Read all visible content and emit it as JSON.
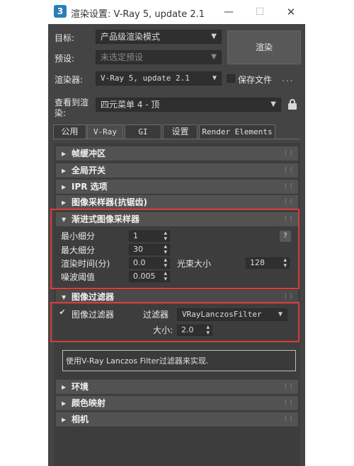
{
  "window": {
    "app_icon": "3",
    "title": "渲染设置: V-Ray 5, update 2.1",
    "minimize_icon": "minimize-icon",
    "maximize_icon": "maximize-icon",
    "close_icon": "close-icon"
  },
  "top": {
    "target_label": "目标:",
    "target_value": "产品级渲染模式",
    "preset_label": "预设:",
    "preset_value": "未选定预设",
    "renderer_label": "渲染器:",
    "renderer_value": "V-Ray 5, update 2.1",
    "save_file_label": "保存文件",
    "more_label": "...",
    "view_label_1": "查看到渲",
    "view_label_2": "染:",
    "view_value": "四元菜单 4 - 顶",
    "render_button": "渲染"
  },
  "tabs": [
    {
      "label": "公用"
    },
    {
      "label": "V-Ray"
    },
    {
      "label": "GI"
    },
    {
      "label": "设置"
    },
    {
      "label": "Render Elements"
    }
  ],
  "active_tab": "V-Ray",
  "rollouts": {
    "frame_buffer": "帧缓冲区",
    "global_switches": "全局开关",
    "ipr_options": "IPR 选项",
    "image_sampler": "图像采样器(抗锯齿)",
    "progressive_sampler": "渐进式图像采样器",
    "image_filter": "图像过滤器",
    "environment": "环境",
    "color_mapping": "颜色映射",
    "camera": "相机"
  },
  "progressive": {
    "min_subdivs_label": "最小细分",
    "min_subdivs_value": "1",
    "max_subdivs_label": "最大细分",
    "max_subdivs_value": "30",
    "render_time_label": "渲染时间(分)",
    "render_time_value": "0.0",
    "bundle_size_label": "光束大小",
    "bundle_size_value": "128",
    "noise_threshold_label": "噪波阈值",
    "noise_threshold_value": "0.005",
    "help_button": "?"
  },
  "filter": {
    "enable_label": "图像过滤器",
    "enabled": true,
    "filter_label": "过滤器",
    "filter_value": "VRayLanczosFilter",
    "size_label": "大小:",
    "size_value": "2.0",
    "description": "使用V-Ray Lanczos Filter过滤器来实现."
  },
  "colors": {
    "highlight": "#e03a3a",
    "window_bg": "#444444",
    "panel_bg": "#3d3d3d"
  }
}
